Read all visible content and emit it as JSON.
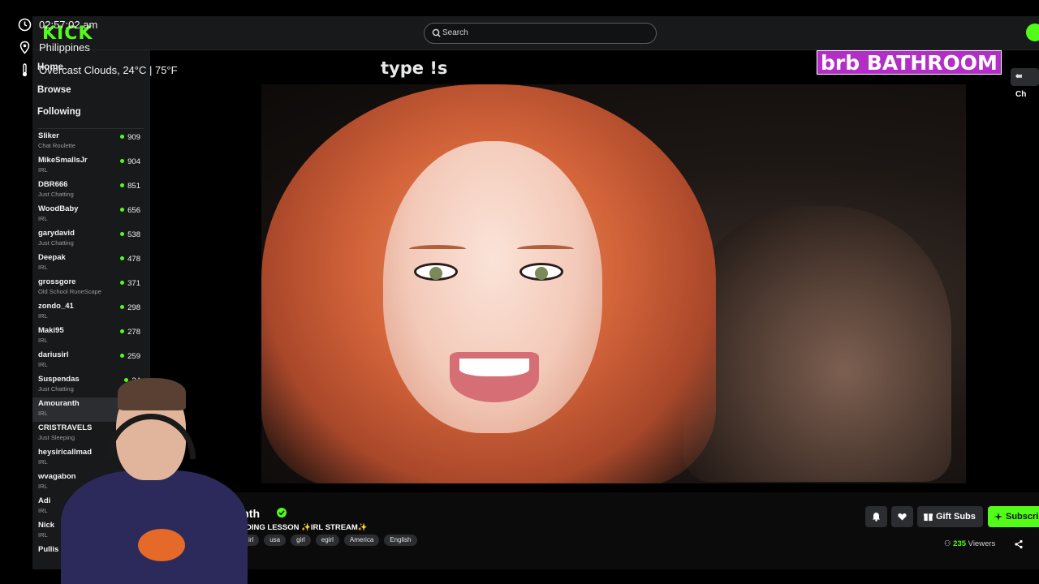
{
  "overlay": {
    "time": "02:57:02 am",
    "location": "Philippines",
    "weather": "Overcast Clouds, 24°C | 75°F"
  },
  "header": {
    "logo": "KICK",
    "search_placeholder": "Search"
  },
  "sidebar": {
    "nav": [
      "Home",
      "Browse",
      "Following"
    ],
    "channels": [
      {
        "name": "",
        "category": "IRL",
        "viewers": ""
      },
      {
        "name": "Sliker",
        "category": "Chat Roulette",
        "viewers": "909"
      },
      {
        "name": "MikeSmallsJr",
        "category": "IRL",
        "viewers": "904"
      },
      {
        "name": "DBR666",
        "category": "Just Chatting",
        "viewers": "851"
      },
      {
        "name": "WoodBaby",
        "category": "IRL",
        "viewers": "656"
      },
      {
        "name": "garydavid",
        "category": "Just Chatting",
        "viewers": "538"
      },
      {
        "name": "Deepak",
        "category": "IRL",
        "viewers": "478"
      },
      {
        "name": "grossgore",
        "category": "Old School RuneScape",
        "viewers": "371"
      },
      {
        "name": "zondo_41",
        "category": "IRL",
        "viewers": "298"
      },
      {
        "name": "Maki95",
        "category": "IRL",
        "viewers": "278"
      },
      {
        "name": "dariusirl",
        "category": "IRL",
        "viewers": "259"
      },
      {
        "name": "Suspendas",
        "category": "Just Chatting",
        "viewers": "24"
      },
      {
        "name": "Amouranth",
        "category": "IRL",
        "viewers": ""
      },
      {
        "name": "CRISTRAVELS",
        "category": "Just Sleeping",
        "viewers": ""
      },
      {
        "name": "heysiricallmad",
        "category": "IRL",
        "viewers": ""
      },
      {
        "name": "wvagabon",
        "category": "IRL",
        "viewers": ""
      },
      {
        "name": "Adi",
        "category": "IRL",
        "viewers": ""
      },
      {
        "name": "Nick",
        "category": "IRL",
        "viewers": ""
      },
      {
        "name": "Pullis",
        "category": "",
        "viewers": ""
      }
    ]
  },
  "video": {
    "overlay_text": "type !s",
    "brb_text": "brb BATHROOM",
    "chat_button": "Ch"
  },
  "stream_info": {
    "channel_name": "ranth",
    "title": "DING LESSON ✨IRL STREAM✨",
    "tags": [
      "irl",
      "usa",
      "girl",
      "egirl",
      "America",
      "English"
    ],
    "gift_label": "Gift Subs",
    "subscribe_label": "Subscri",
    "viewer_count": "235",
    "viewer_suffix": "Viewers"
  },
  "colors": {
    "accent": "#53fc18",
    "brb_bg": "#b22fc6",
    "panel": "#18191b"
  }
}
